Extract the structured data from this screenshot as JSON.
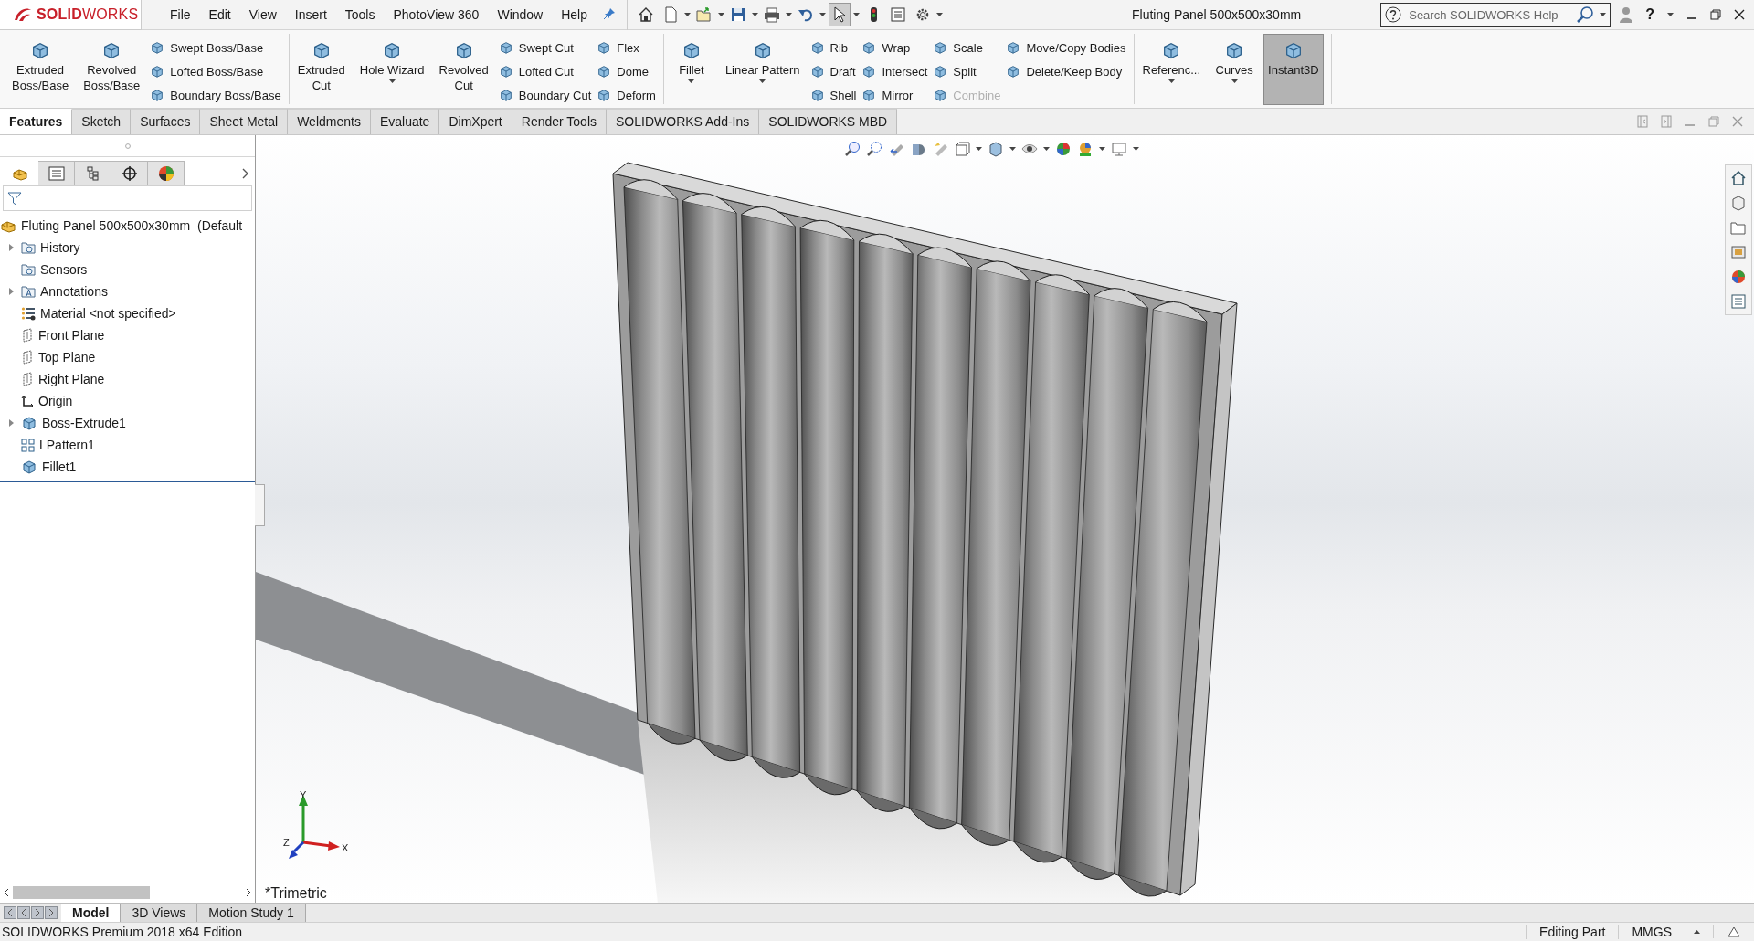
{
  "app": {
    "logo": "**SOLID**WORKS"
  },
  "menu": [
    {
      "label": "File"
    },
    {
      "label": "Edit"
    },
    {
      "label": "View"
    },
    {
      "label": "Insert"
    },
    {
      "label": "Tools"
    },
    {
      "label": "PhotoView 360"
    },
    {
      "label": "Window"
    },
    {
      "label": "Help"
    }
  ],
  "quick_access": [
    {
      "selected": false
    },
    {
      "selected": false
    },
    {
      "selected": false
    },
    {
      "selected": false
    },
    {
      "selected": false
    },
    {
      "selected": false
    },
    {
      "selected": true
    },
    {
      "selected": false
    },
    {
      "selected": false
    },
    {
      "selected": false
    }
  ],
  "title": "Fluting Panel 500x500x30mm",
  "search": {
    "placeholder": "Search SOLIDWORKS Help"
  },
  "help": "?",
  "ribbon": [
    {
      "items": [
        {
          "kind": "large",
          "label": "Extruded\nBoss/Base",
          "dropdown": false,
          "selected": false
        },
        {
          "kind": "large",
          "label": "Revolved\nBoss/Base",
          "dropdown": false,
          "selected": false
        },
        {
          "kind": "column",
          "items": [
            {
              "label": "Swept Boss/Base",
              "disabled": false
            },
            {
              "label": "Lofted Boss/Base",
              "disabled": false
            },
            {
              "label": "Boundary Boss/Base",
              "disabled": false
            }
          ]
        }
      ]
    },
    {
      "items": [
        {
          "kind": "large",
          "label": "Extruded\nCut",
          "dropdown": false,
          "selected": false
        },
        {
          "kind": "large",
          "label": "Hole Wizard",
          "dropdown": true,
          "selected": false
        },
        {
          "kind": "large",
          "label": "Revolved\nCut",
          "dropdown": false,
          "selected": false
        },
        {
          "kind": "column",
          "items": [
            {
              "label": "Swept Cut",
              "disabled": false
            },
            {
              "label": "Lofted Cut",
              "disabled": false
            },
            {
              "label": "Boundary Cut",
              "disabled": false
            }
          ]
        },
        {
          "kind": "column",
          "items": [
            {
              "label": "Flex",
              "disabled": false
            },
            {
              "label": "Dome",
              "disabled": false
            },
            {
              "label": "Deform",
              "disabled": false
            }
          ]
        }
      ]
    },
    {
      "items": [
        {
          "kind": "large",
          "label": "Fillet",
          "dropdown": true,
          "selected": false
        },
        {
          "kind": "large",
          "label": "Linear Pattern",
          "dropdown": true,
          "selected": false
        },
        {
          "kind": "column",
          "items": [
            {
              "label": "Rib",
              "disabled": false
            },
            {
              "label": "Draft",
              "disabled": false
            },
            {
              "label": "Shell",
              "disabled": false
            }
          ]
        },
        {
          "kind": "column",
          "items": [
            {
              "label": "Wrap",
              "disabled": false
            },
            {
              "label": "Intersect",
              "disabled": false
            },
            {
              "label": "Mirror",
              "disabled": false
            }
          ]
        },
        {
          "kind": "column",
          "items": [
            {
              "label": "Scale",
              "disabled": false
            },
            {
              "label": "Split",
              "disabled": false
            },
            {
              "label": "Combine",
              "disabled": true
            }
          ]
        },
        {
          "kind": "column",
          "items": [
            {
              "label": "Move/Copy Bodies",
              "disabled": false
            },
            {
              "label": "Delete/Keep Body",
              "disabled": false
            }
          ]
        }
      ]
    },
    {
      "items": [
        {
          "kind": "large",
          "label": "Referenc...",
          "dropdown": true,
          "selected": false
        },
        {
          "kind": "large",
          "label": "Curves",
          "dropdown": true,
          "selected": false
        },
        {
          "kind": "large",
          "label": "Instant3D",
          "dropdown": false,
          "selected": true
        }
      ]
    }
  ],
  "command_tabs": [
    {
      "label": "Features",
      "selected": true
    },
    {
      "label": "Sketch",
      "selected": false
    },
    {
      "label": "Surfaces",
      "selected": false
    },
    {
      "label": "Sheet Metal",
      "selected": false
    },
    {
      "label": "Weldments",
      "selected": false
    },
    {
      "label": "Evaluate",
      "selected": false
    },
    {
      "label": "DimXpert",
      "selected": false
    },
    {
      "label": "Render Tools",
      "selected": false
    },
    {
      "label": "SOLIDWORKS Add-Ins",
      "selected": false
    },
    {
      "label": "SOLIDWORKS MBD",
      "selected": false
    }
  ],
  "panel_tabs": [
    {
      "selected": true
    },
    {
      "selected": false
    },
    {
      "selected": false
    },
    {
      "selected": false
    },
    {
      "selected": false
    }
  ],
  "tree": {
    "root": "Fluting Panel 500x500x30mm  (Default",
    "items": [
      {
        "label": "History",
        "expandable": true
      },
      {
        "label": "Sensors",
        "expandable": false
      },
      {
        "label": "Annotations",
        "expandable": true
      },
      {
        "label": "Material <not specified>",
        "expandable": false
      },
      {
        "label": "Front Plane",
        "expandable": false
      },
      {
        "label": "Top Plane",
        "expandable": false
      },
      {
        "label": "Right Plane",
        "expandable": false
      },
      {
        "label": "Origin",
        "expandable": false
      },
      {
        "label": "Boss-Extrude1",
        "expandable": true
      },
      {
        "label": "LPattern1",
        "expandable": false
      },
      {
        "label": "Fillet1",
        "expandable": false
      }
    ]
  },
  "view_name": "*Trimetric",
  "triad": [
    "X",
    "Y",
    "Z"
  ],
  "model_tabs": [
    {
      "label": "Model",
      "selected": true
    },
    {
      "label": "3D Views",
      "selected": false
    },
    {
      "label": "Motion Study 1",
      "selected": false
    }
  ],
  "status": {
    "edition": "SOLIDWORKS Premium 2018 x64 Edition",
    "mode": "Editing Part",
    "units": "MMGS"
  }
}
